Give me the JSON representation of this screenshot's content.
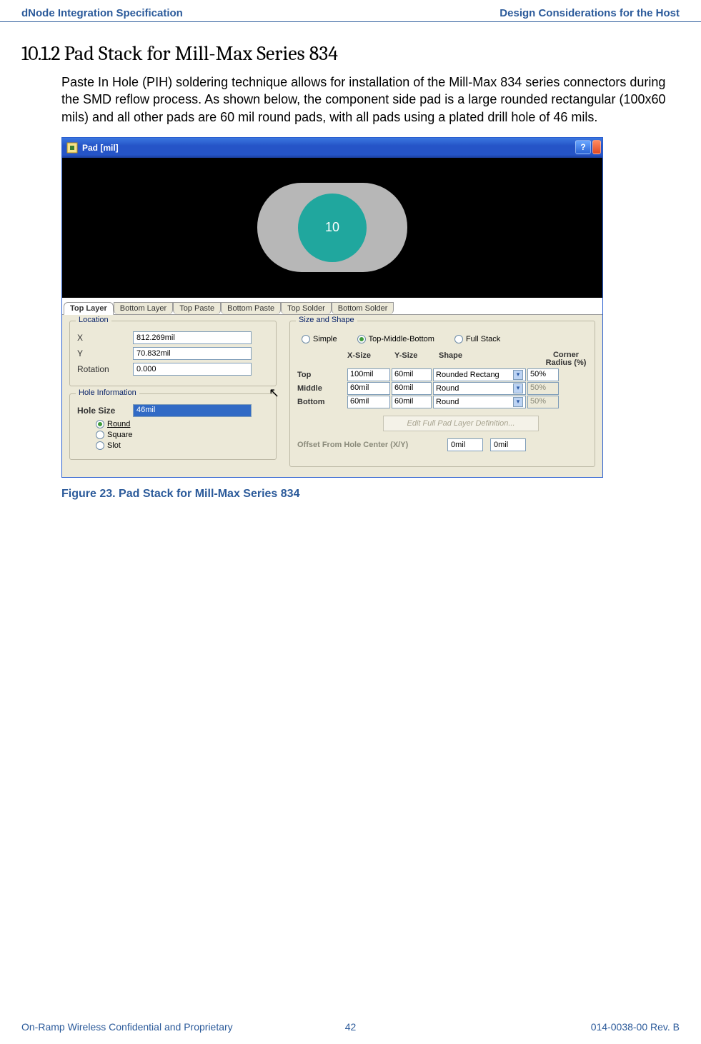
{
  "header": {
    "left": "dNode Integration Specification",
    "right": "Design Considerations for the Host"
  },
  "section": {
    "number": "10.1.2",
    "title": "Pad Stack for Mill-Max Series 834"
  },
  "paragraph": "Paste In Hole (PIH) soldering technique allows for installation of the Mill-Max 834 series connectors during the SMD reflow process. As shown below, the component side pad is a large rounded rectangular (100x60 mils) and all other pads are 60 mil round pads, with all pads using a plated drill hole of 46 mils.",
  "dialog": {
    "title": "Pad [mil]",
    "preview_label": "10",
    "tabs": [
      "Top Layer",
      "Bottom Layer",
      "Top Paste",
      "Bottom Paste",
      "Top Solder",
      "Bottom Solder"
    ],
    "active_tab": 0,
    "location": {
      "legend": "Location",
      "x_label": "X",
      "x_value": "812.269mil",
      "y_label": "Y",
      "y_value": "70.832mil",
      "rot_label": "Rotation",
      "rot_value": "0.000"
    },
    "hole": {
      "legend": "Hole Information",
      "size_label": "Hole Size",
      "size_value": "46mil",
      "options": [
        "Round",
        "Square",
        "Slot"
      ],
      "selected": 0
    },
    "size_shape": {
      "legend": "Size and Shape",
      "modes": [
        "Simple",
        "Top-Middle-Bottom",
        "Full Stack"
      ],
      "mode_selected": 1,
      "col_headers": [
        "X-Size",
        "Y-Size",
        "Shape",
        "Corner Radius (%)"
      ],
      "rows": [
        {
          "label": "Top",
          "x": "100mil",
          "y": "60mil",
          "shape": "Rounded Rectang",
          "cr": "50%",
          "cr_disabled": false
        },
        {
          "label": "Middle",
          "x": "60mil",
          "y": "60mil",
          "shape": "Round",
          "cr": "50%",
          "cr_disabled": true
        },
        {
          "label": "Bottom",
          "x": "60mil",
          "y": "60mil",
          "shape": "Round",
          "cr": "50%",
          "cr_disabled": true
        }
      ],
      "edit_button": "Edit Full Pad Layer Definition...",
      "offset_label": "Offset From Hole Center (X/Y)",
      "offset_x": "0mil",
      "offset_y": "0mil"
    }
  },
  "figure_caption": "Figure 23. Pad Stack for Mill-Max Series 834",
  "footer": {
    "left": "On-Ramp Wireless Confidential and Proprietary",
    "center": "42",
    "right": "014-0038-00 Rev. B"
  },
  "win_help": "?"
}
